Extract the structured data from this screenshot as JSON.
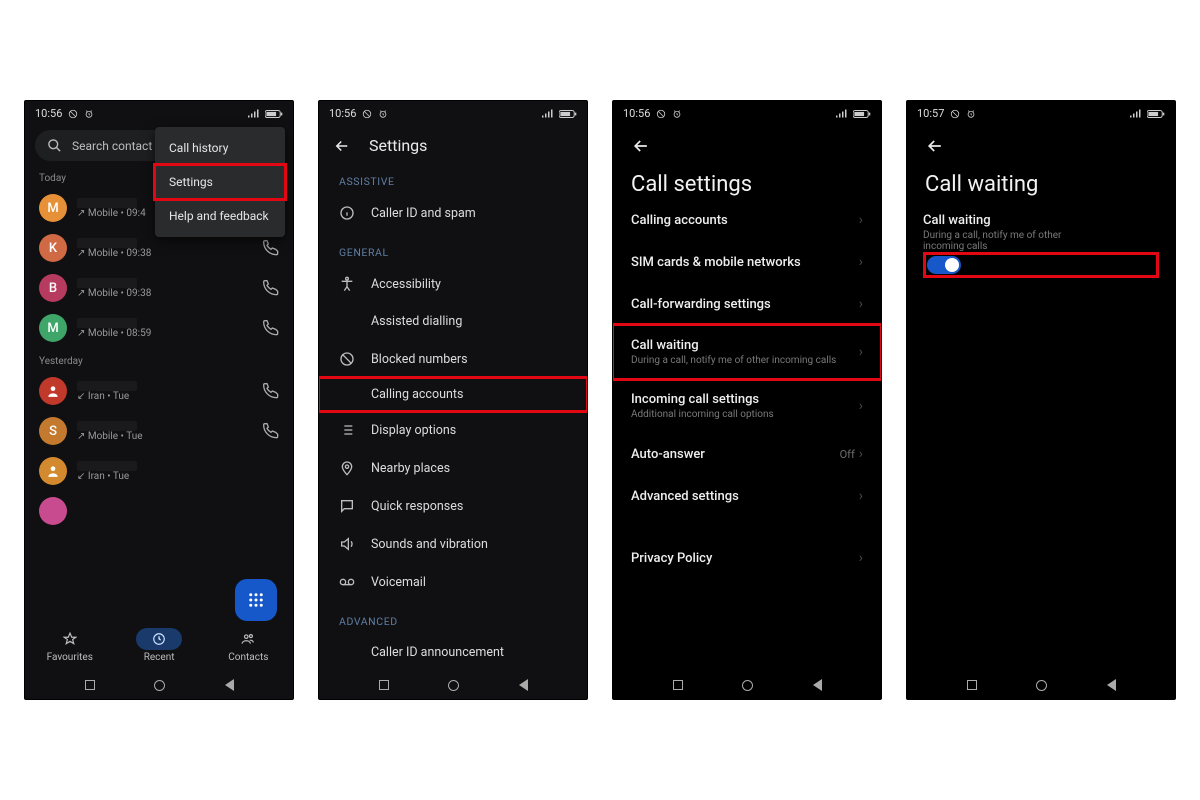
{
  "status": {
    "time_a": "10:56",
    "time_b": "10:57"
  },
  "screen1": {
    "search_placeholder": "Search contact",
    "menu": {
      "history": "Call history",
      "settings": "Settings",
      "help": "Help and feedback"
    },
    "sections": {
      "today": "Today",
      "yesterday": "Yesterday"
    },
    "calls_today": [
      {
        "letter": "M",
        "color": "#e69138",
        "sub": "↗ Mobile • 09:4"
      },
      {
        "letter": "K",
        "color": "#d06a45",
        "sub": "↗ Mobile • 09:38"
      },
      {
        "letter": "B",
        "color": "#b73b5e",
        "sub": "↗ Mobile • 09:38"
      },
      {
        "letter": "M",
        "color": "#3fa66a",
        "sub": "↗ Mobile • 08:59"
      }
    ],
    "calls_yesterday": [
      {
        "letter": "",
        "color": "#c0392b",
        "sub": "↙ Iran • Tue",
        "person": true
      },
      {
        "letter": "S",
        "color": "#c47a2e",
        "sub": "↗ Mobile • Tue"
      },
      {
        "letter": "",
        "color": "#d38a2e",
        "sub": "↙ Iran • Tue",
        "person": true
      }
    ],
    "tabs": {
      "fav": "Favourites",
      "recent": "Recent",
      "contacts": "Contacts"
    }
  },
  "screen2": {
    "title": "Settings",
    "sections": {
      "assistive": "ASSISTIVE",
      "general": "GENERAL",
      "advanced": "ADVANCED"
    },
    "items": {
      "caller_id_spam": "Caller ID and spam",
      "accessibility": "Accessibility",
      "assisted_dialling": "Assisted dialling",
      "blocked_numbers": "Blocked numbers",
      "calling_accounts": "Calling accounts",
      "display_options": "Display options",
      "nearby_places": "Nearby places",
      "quick_responses": "Quick responses",
      "sounds_vibration": "Sounds and vibration",
      "voicemail": "Voicemail",
      "caller_id_announce": "Caller ID announcement"
    }
  },
  "screen3": {
    "title": "Call settings",
    "items": {
      "calling_accounts": "Calling accounts",
      "sim_networks": "SIM cards & mobile networks",
      "call_forwarding": "Call-forwarding settings",
      "call_waiting": "Call waiting",
      "call_waiting_sub": "During a call, notify me of other incoming calls",
      "incoming": "Incoming call settings",
      "incoming_sub": "Additional incoming call options",
      "auto_answer": "Auto-answer",
      "auto_answer_val": "Off",
      "advanced": "Advanced settings",
      "privacy": "Privacy Policy"
    }
  },
  "screen4": {
    "title": "Call waiting",
    "item": "Call waiting",
    "item_sub": "During a call, notify me of other incoming calls"
  }
}
